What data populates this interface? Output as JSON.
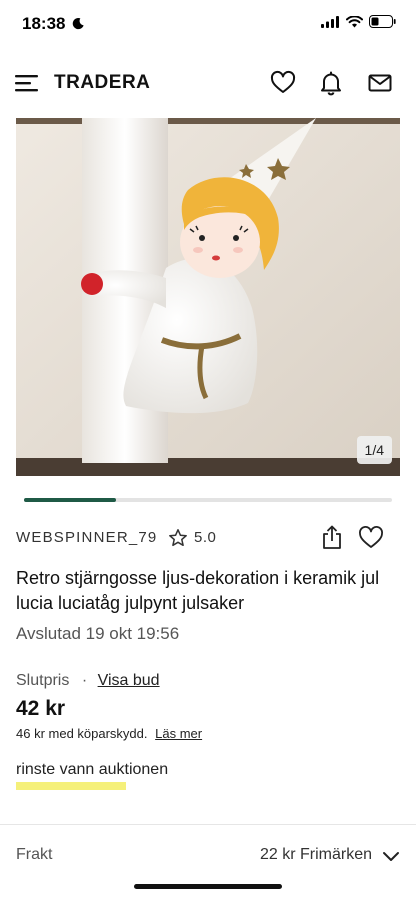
{
  "status_bar": {
    "time": "18:38"
  },
  "header": {
    "logo": "TRADERA"
  },
  "gallery": {
    "counter": "1/4",
    "progress": 0.25
  },
  "seller": {
    "name": "WEBSPINNER_79",
    "rating": "5.0"
  },
  "item": {
    "title": "Retro stjärngosse ljus-dekoration i keramik jul lucia luciatåg julpynt julsaker",
    "ended": "Avslutad 19 okt 19:56"
  },
  "price": {
    "label": "Slutpris",
    "separator": "·",
    "bids_link": "Visa bud",
    "value": "42 kr",
    "protection_text": "46 kr med köparskydd.",
    "learn_more": "Läs mer"
  },
  "note": "rinste vann auktionen",
  "shipping": {
    "label": "Frakt",
    "value": "22 kr Frimärken"
  },
  "colors": {
    "progress": "#1f5a46",
    "highlight": "#f5f07a"
  },
  "icons": [
    "moon-icon",
    "signal-icon",
    "wifi-icon",
    "battery-icon",
    "menu-icon",
    "heart-icon",
    "bell-icon",
    "mail-icon",
    "star-icon",
    "share-icon",
    "chevron-down-icon"
  ]
}
